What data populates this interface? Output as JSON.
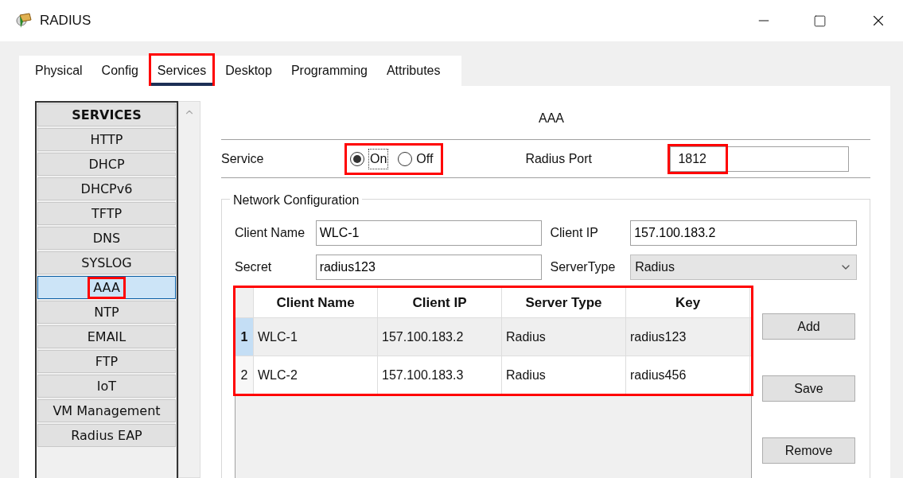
{
  "window": {
    "title": "RADIUS"
  },
  "tabs": [
    {
      "label": "Physical",
      "selected": false,
      "highlighted": false
    },
    {
      "label": "Config",
      "selected": false,
      "highlighted": false
    },
    {
      "label": "Services",
      "selected": true,
      "highlighted": true
    },
    {
      "label": "Desktop",
      "selected": false,
      "highlighted": false
    },
    {
      "label": "Programming",
      "selected": false,
      "highlighted": false
    },
    {
      "label": "Attributes",
      "selected": false,
      "highlighted": false
    }
  ],
  "sidebar": {
    "heading": "SERVICES",
    "items": [
      {
        "label": "HTTP",
        "selected": false,
        "highlighted": false
      },
      {
        "label": "DHCP",
        "selected": false,
        "highlighted": false
      },
      {
        "label": "DHCPv6",
        "selected": false,
        "highlighted": false
      },
      {
        "label": "TFTP",
        "selected": false,
        "highlighted": false
      },
      {
        "label": "DNS",
        "selected": false,
        "highlighted": false
      },
      {
        "label": "SYSLOG",
        "selected": false,
        "highlighted": false
      },
      {
        "label": "AAA",
        "selected": true,
        "highlighted": true
      },
      {
        "label": "NTP",
        "selected": false,
        "highlighted": false
      },
      {
        "label": "EMAIL",
        "selected": false,
        "highlighted": false
      },
      {
        "label": "FTP",
        "selected": false,
        "highlighted": false
      },
      {
        "label": "IoT",
        "selected": false,
        "highlighted": false
      },
      {
        "label": "VM Management",
        "selected": false,
        "highlighted": false
      },
      {
        "label": "Radius EAP",
        "selected": false,
        "highlighted": false
      }
    ]
  },
  "panel": {
    "title": "AAA",
    "service": {
      "label": "Service",
      "highlighted": true,
      "options": [
        {
          "label": "On",
          "selected": true
        },
        {
          "label": "Off",
          "selected": false
        }
      ]
    },
    "port": {
      "label": "Radius Port",
      "value": "1812",
      "highlighted": true
    },
    "network": {
      "legend": "Network Configuration",
      "client_name": {
        "label": "Client Name",
        "value": "WLC-1"
      },
      "client_ip": {
        "label": "Client IP",
        "value": "157.100.183.2"
      },
      "secret": {
        "label": "Secret",
        "value": "radius123"
      },
      "server_type": {
        "label": "ServerType",
        "value": "Radius"
      }
    },
    "table": {
      "highlighted": true,
      "columns": [
        "Client Name",
        "Client IP",
        "Server Type",
        "Key"
      ],
      "rows": [
        {
          "number": "1",
          "selected": true,
          "cells": [
            "WLC-1",
            "157.100.183.2",
            "Radius",
            "radius123"
          ]
        },
        {
          "number": "2",
          "selected": false,
          "cells": [
            "WLC-2",
            "157.100.183.3",
            "Radius",
            "radius456"
          ]
        }
      ]
    },
    "buttons": [
      "Add",
      "Save",
      "Remove"
    ]
  }
}
